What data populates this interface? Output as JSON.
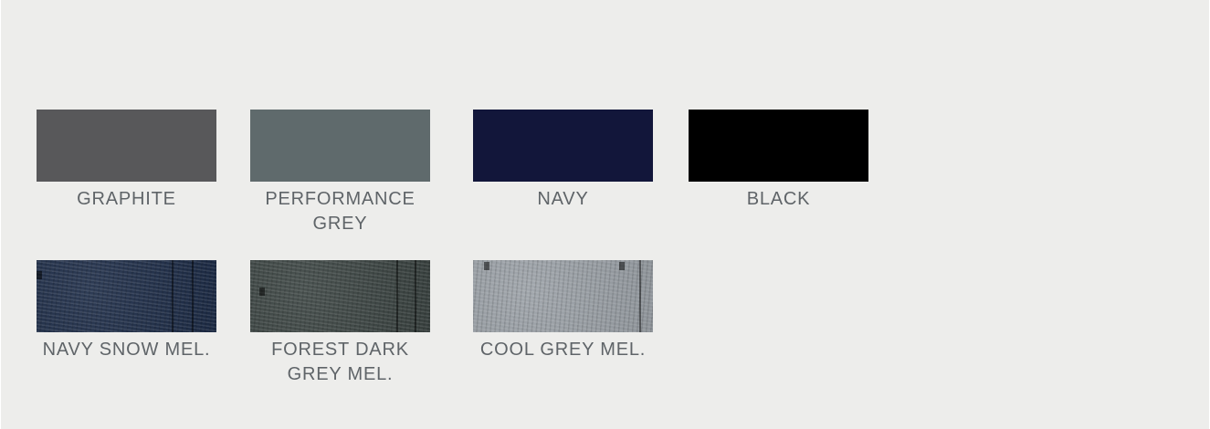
{
  "swatches": [
    {
      "label": "GRAPHITE",
      "color": "#58585a",
      "textured": false
    },
    {
      "label": "PERFORMANCE GREY",
      "color": "#5f6a6c",
      "textured": false
    },
    {
      "label": "NAVY",
      "color": "#12163a",
      "textured": false
    },
    {
      "label": "BLACK",
      "color": "#000000",
      "textured": false
    },
    {
      "label": "NAVY SNOW MEL.",
      "color": "#1d2c47",
      "textured": true
    },
    {
      "label": "FOREST DARK GREY MEL.",
      "color": "#3b4442",
      "textured": true
    },
    {
      "label": "COOL GREY MEL.",
      "color": "#9aa0a6",
      "textured": true
    }
  ]
}
